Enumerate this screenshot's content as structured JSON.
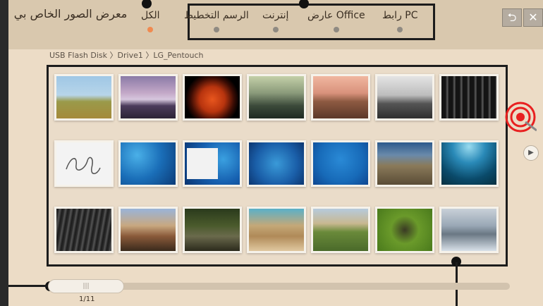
{
  "app_title": "معرض الصور الخاص بي",
  "tabs": [
    {
      "label": "الكل",
      "active": true
    },
    {
      "label": "الرسم التخطيط",
      "active": false
    },
    {
      "label": "إنترنت",
      "active": false
    },
    {
      "label": "عارض Office",
      "active": false
    },
    {
      "label": "رابط PC",
      "active": false
    }
  ],
  "toolbar": {
    "back_icon": "back-icon",
    "close_icon": "close-icon",
    "back_symbol": "⮌",
    "close_symbol": "✕"
  },
  "breadcrumb": "USB Flash Disk 〉Drive1 〉LG_Pentouch",
  "pagination": {
    "page": "1/11",
    "next_symbol": "▶"
  },
  "colors": {
    "background": "#ecdcc6",
    "active_dot": "#f08a50",
    "callout": "#1c1c1c"
  },
  "thumbnails": [
    "thumbnail-1",
    "thumbnail-2",
    "thumbnail-3",
    "thumbnail-4",
    "thumbnail-5",
    "thumbnail-6",
    "thumbnail-7",
    "thumbnail-8",
    "thumbnail-9",
    "thumbnail-10",
    "thumbnail-11",
    "thumbnail-12",
    "thumbnail-13",
    "thumbnail-14",
    "thumbnail-15",
    "thumbnail-16",
    "thumbnail-17",
    "thumbnail-18",
    "thumbnail-19",
    "thumbnail-20",
    "thumbnail-21"
  ]
}
